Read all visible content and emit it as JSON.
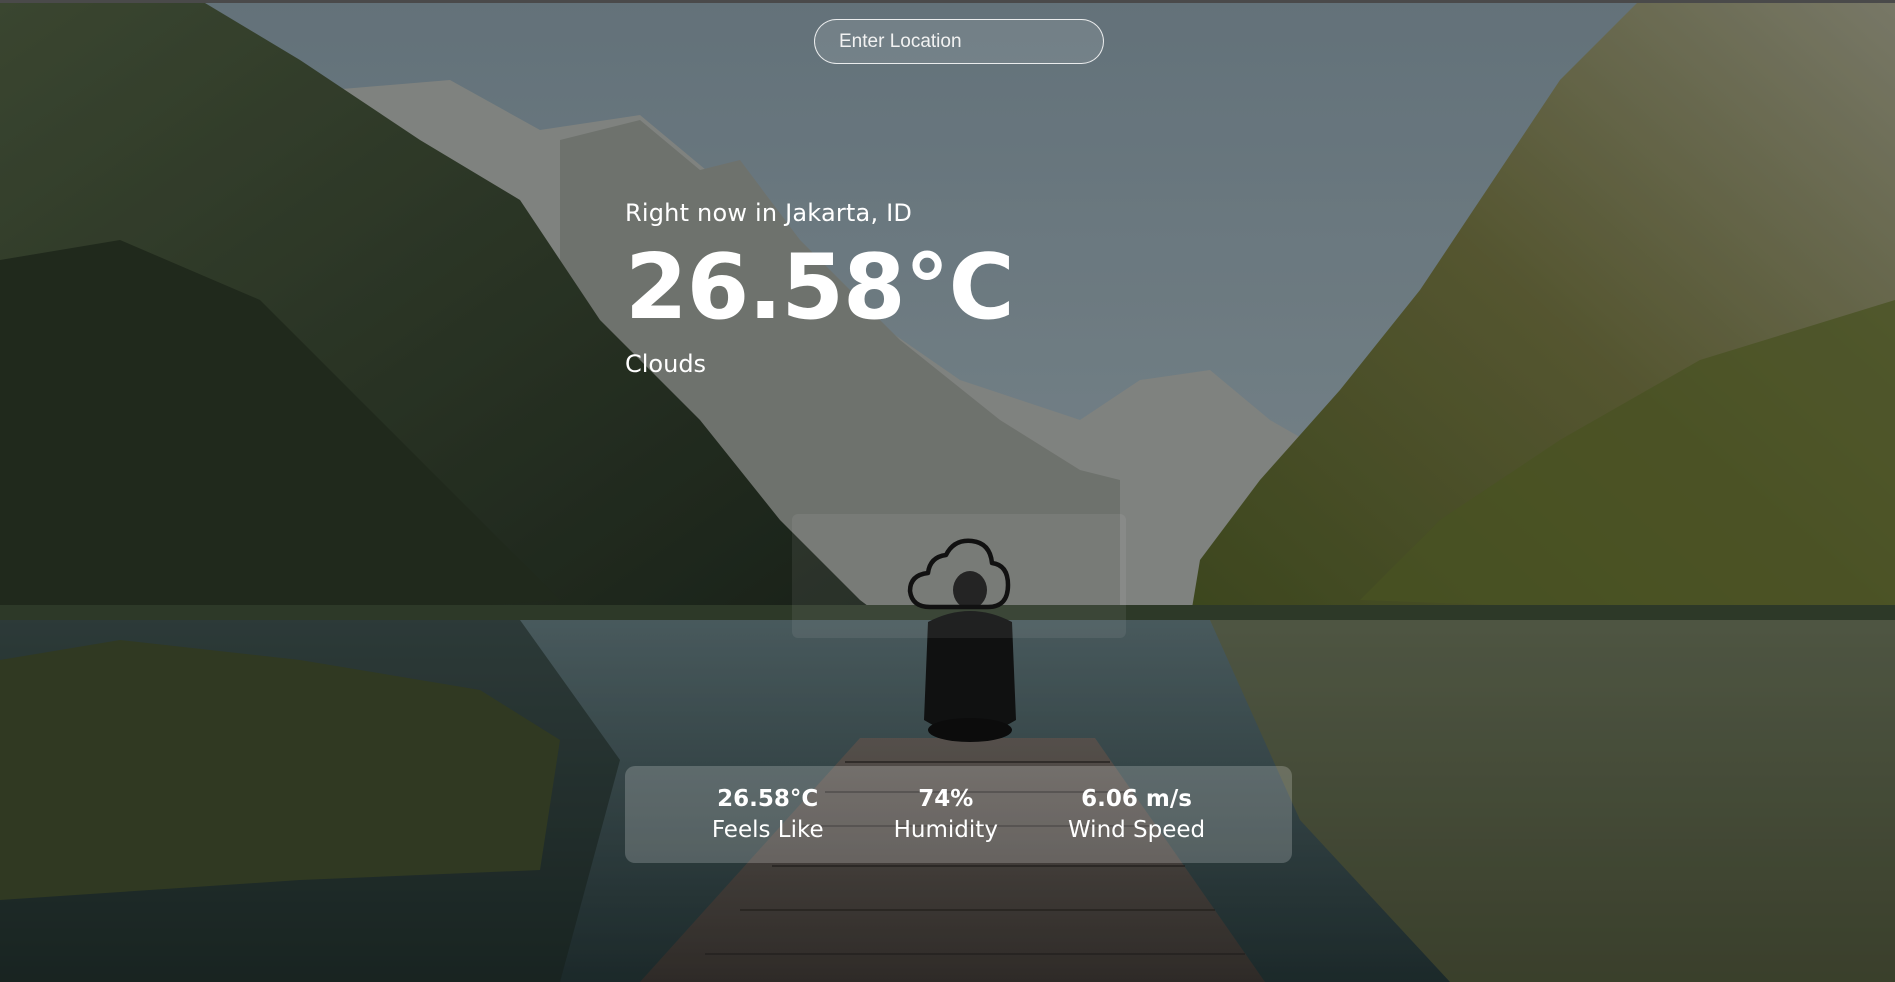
{
  "search": {
    "placeholder": "Enter Location"
  },
  "current": {
    "location_line": "Right now in Jakarta, ID",
    "temperature": "26.58°C",
    "description": "Clouds",
    "icon": "cloud-icon"
  },
  "stats": [
    {
      "value": "26.58°C",
      "label": "Feels Like"
    },
    {
      "value": "74%",
      "label": "Humidity"
    },
    {
      "value": "6.06 m/s",
      "label": "Wind Speed"
    }
  ],
  "colors": {
    "text": "#ffffff",
    "sky": "#8fa1ac",
    "lake": "#2e4a4e"
  }
}
